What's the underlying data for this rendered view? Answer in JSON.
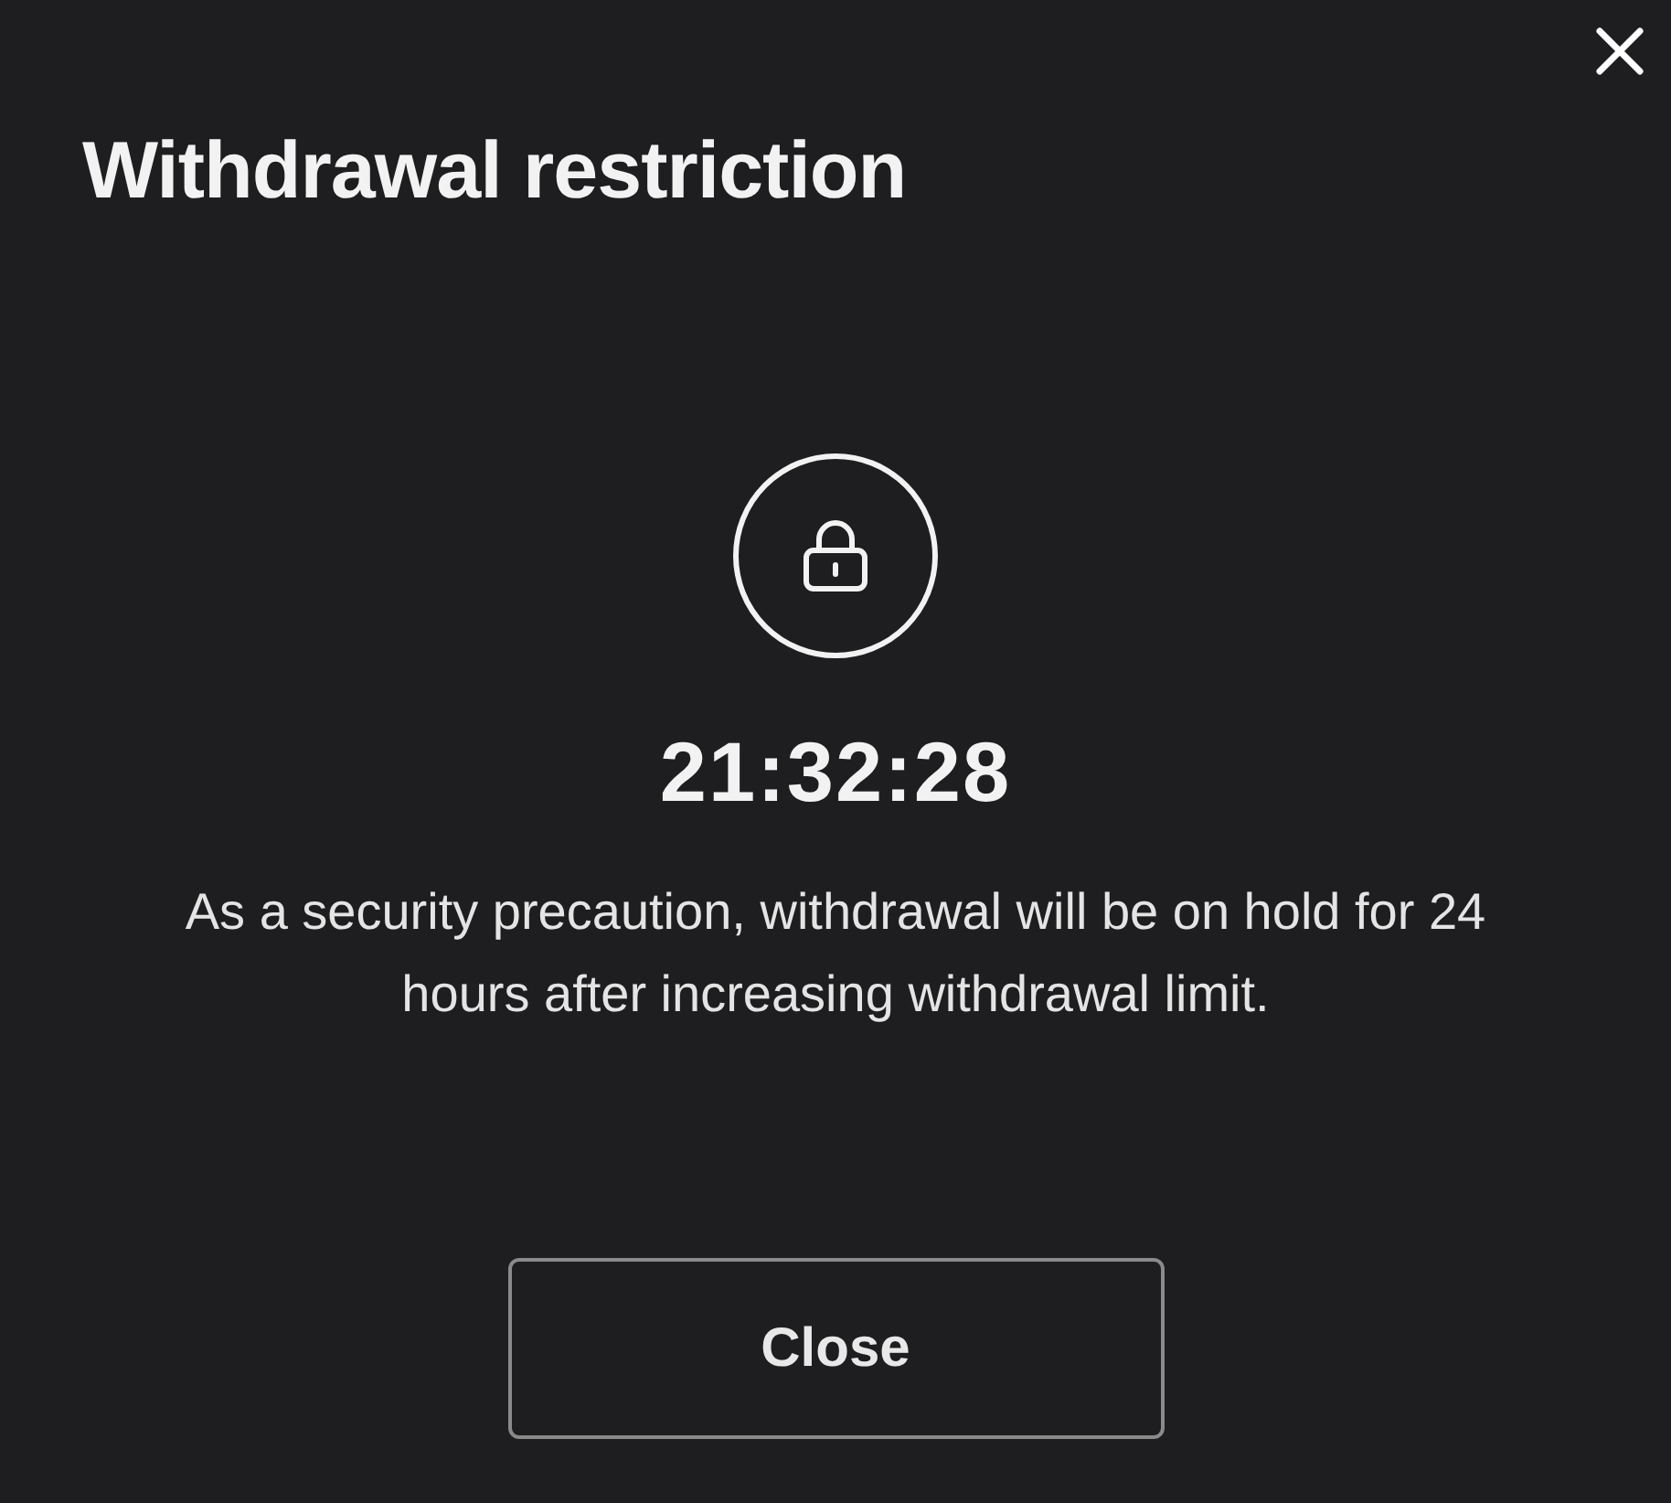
{
  "dialog": {
    "title": "Withdrawal restriction",
    "countdown": "21:32:28",
    "message": "As a security precaution, withdrawal will be on hold for 24 hours after increasing withdrawal limit.",
    "buttons": [
      "Close"
    ]
  }
}
